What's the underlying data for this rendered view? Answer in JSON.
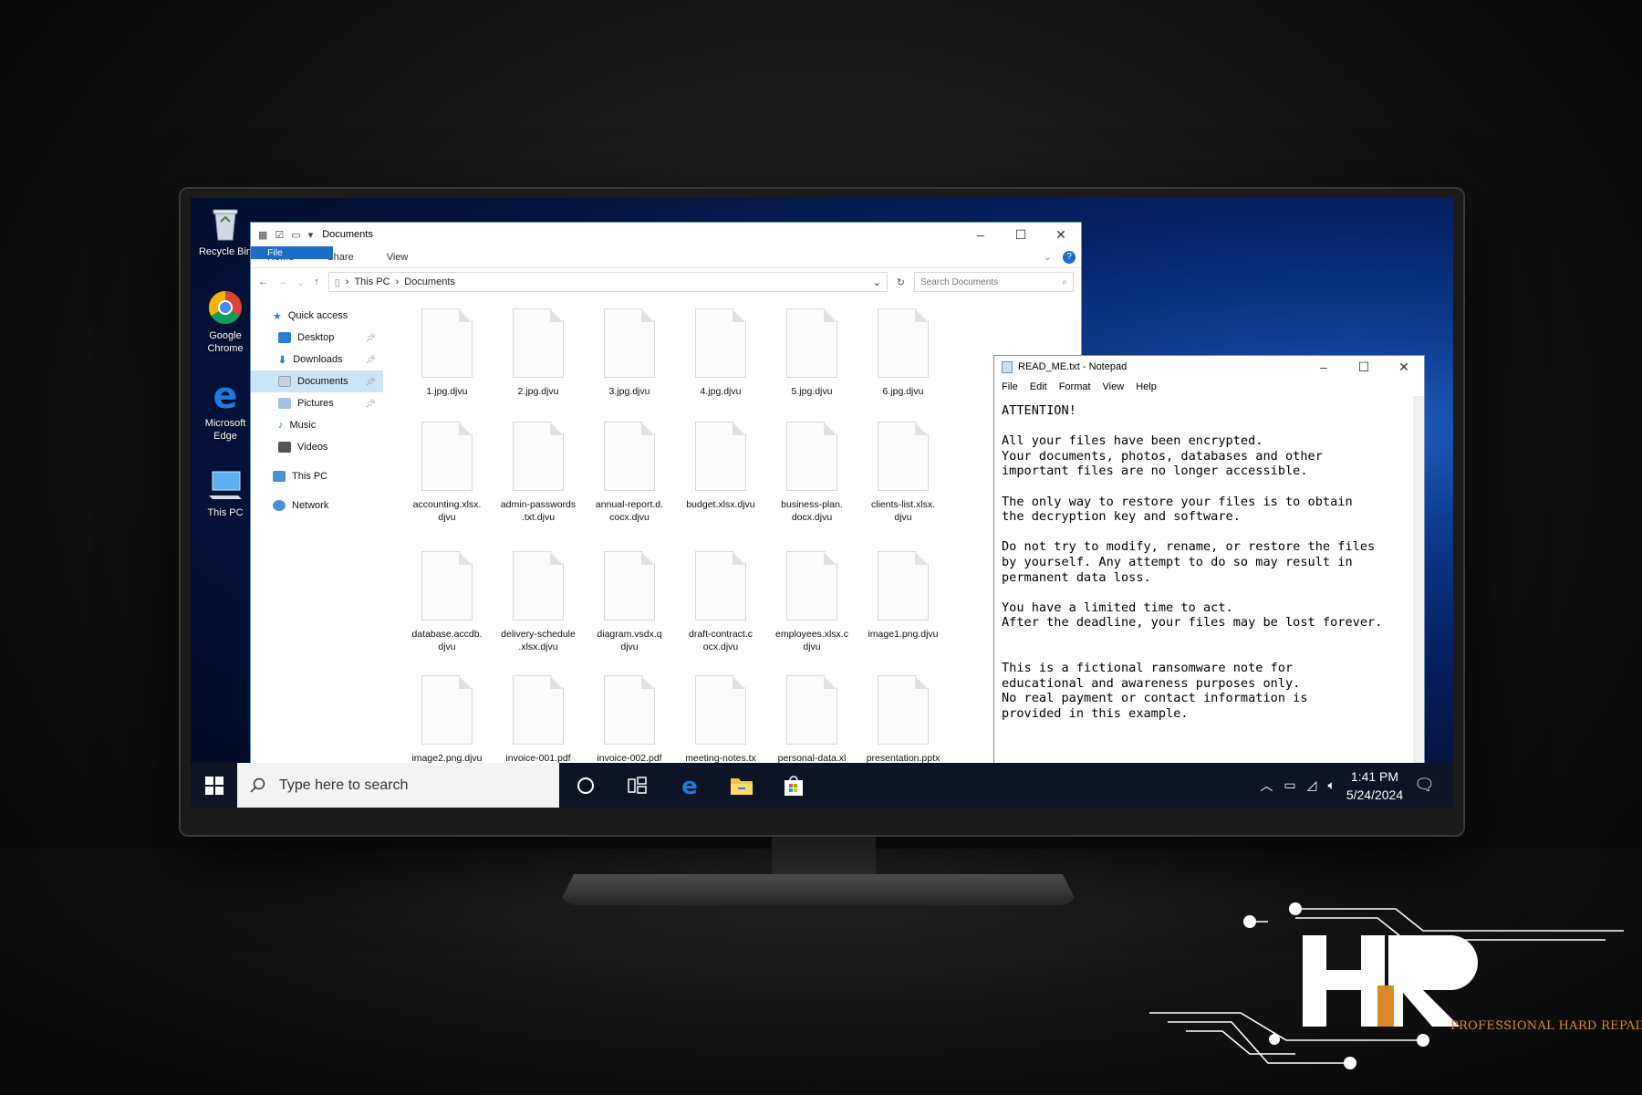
{
  "desktop": {
    "icons": [
      {
        "label": "Recycle Bin",
        "icon": "recycle-bin-icon"
      },
      {
        "label": "Google Chrome",
        "icon": "chrome-icon"
      },
      {
        "label": "Microsoft Edge",
        "icon": "edge-icon"
      },
      {
        "label": "This PC",
        "icon": "this-pc-icon"
      }
    ]
  },
  "explorer": {
    "title": "Documents",
    "ribbon_tabs": [
      "File",
      "Home",
      "Share",
      "View"
    ],
    "breadcrumb": [
      "This PC",
      "Documents"
    ],
    "search_placeholder": "Search Documents",
    "nav": [
      {
        "label": "Quick access",
        "icon": "star-icon",
        "color": "#2b7cd3"
      },
      {
        "label": "Desktop",
        "icon": "desktop-icon",
        "color": "#2b7cd3",
        "pinned": true
      },
      {
        "label": "Downloads",
        "icon": "download-icon",
        "color": "#2b7cd3",
        "pinned": true
      },
      {
        "label": "Documents",
        "icon": "documents-icon",
        "color": "#8aa0bf",
        "pinned": true,
        "selected": true
      },
      {
        "label": "Pictures",
        "icon": "pictures-icon",
        "color": "#7aa4c8",
        "pinned": true
      },
      {
        "label": "Music",
        "icon": "music-icon",
        "color": "#2b7cd3"
      },
      {
        "label": "Videos",
        "icon": "videos-icon",
        "color": "#555555"
      },
      {
        "label": "This PC",
        "icon": "this-pc-icon",
        "color": "#4a8fd6"
      },
      {
        "label": "Network",
        "icon": "network-icon",
        "color": "#4a8fd6"
      }
    ],
    "files": [
      [
        "1.jpg.djvu",
        "2.jpg.djvu",
        "3.jpg.djvu",
        "4.jpg.djvu",
        "5.jpg.djvu",
        "6.jpg.djvu"
      ],
      [
        "accounting.xlsx.\ndjvu",
        "admin-passwords\n.txt.djvu",
        "annual-report.d.\ncocx.djvu",
        "budget.xlsx.djvu",
        "business-plan.\ndocx.djvu",
        "clients-list.xlsx.\ndjvu"
      ],
      [
        "database.accdb.\ndjvu",
        "delivery-schedule\n.xlsx.djvu",
        "diagram.vsdx.q\ndjvu",
        "draft-contract.c\nocx.djvu",
        "employees.xlsx.c\ndjvu",
        "image1.png.djvu"
      ],
      [
        "image2.png.djvu",
        "invoice-001.pdf",
        "invoice-002.pdf",
        "meeting-notes.tx",
        "personal-data.xl",
        "presentation.pptx"
      ]
    ]
  },
  "notepad": {
    "title": "READ_ME.txt - Notepad",
    "menu": [
      "File",
      "Edit",
      "Format",
      "View",
      "Help"
    ],
    "body": "ATTENTION!\n\nAll your files have been encrypted.\nYour documents, photos, databases and other\nimportant files are no longer accessible.\n\nThe only way to restore your files is to obtain\nthe decryption key and software.\n\nDo not try to modify, rename, or restore the files\nby yourself. Any attempt to do so may result in\npermanent data loss.\n\nYou have a limited time to act.\nAfter the deadline, your files may be lost forever.\n\n\nThis is a fictional ransomware note for\neducational and awareness purposes only.\nNo real payment or contact information is\nprovided in this example."
  },
  "taskbar": {
    "search_placeholder": "Type here to search",
    "time": "1:41 PM",
    "date": "5/24/2024",
    "pinned": [
      "cortana-icon",
      "task-view-icon",
      "edge-icon",
      "file-explorer-icon",
      "store-icon"
    ]
  },
  "logo": {
    "letters": "HR",
    "tagline": "PROFESSIONAL HARD REPAIR",
    "accent": "#d98b2b"
  }
}
